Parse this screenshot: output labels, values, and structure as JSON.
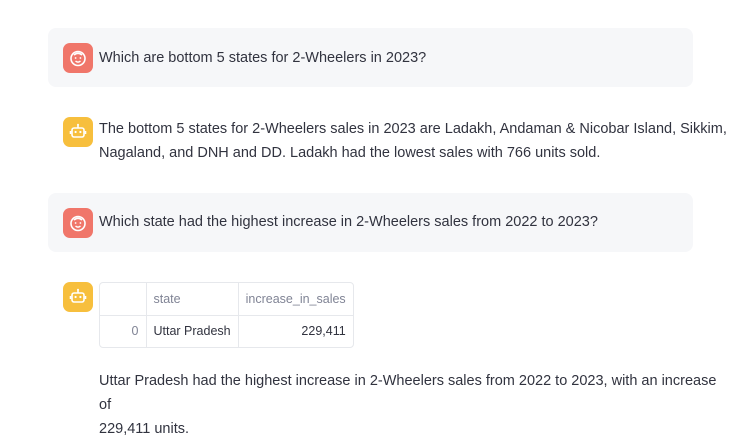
{
  "colors": {
    "user_avatar": "#f0766a",
    "assistant_avatar": "#f7bf3d",
    "user_bubble": "#f6f7f9",
    "text": "#31333f"
  },
  "messages": [
    {
      "role": "user",
      "avatar_icon": "smiley-face-icon",
      "text": "Which are bottom 5 states for 2-Wheelers in 2023?"
    },
    {
      "role": "assistant",
      "avatar_icon": "robot-icon",
      "lines": [
        "The bottom 5 states for 2-Wheelers sales in 2023 are Ladakh, Andaman & Nicobar Island, Sikkim,",
        "Nagaland, and DNH and DD. Ladakh had the lowest sales with 766 units sold."
      ]
    },
    {
      "role": "user",
      "avatar_icon": "smiley-face-icon",
      "text": "Which state had the highest increase in 2-Wheelers sales from 2022 to 2023?"
    },
    {
      "role": "assistant",
      "avatar_icon": "robot-icon",
      "table": {
        "columns": [
          "",
          "state",
          "increase_in_sales"
        ],
        "rows": [
          [
            "0",
            "Uttar Pradesh",
            "229,411"
          ]
        ]
      },
      "lines": [
        "Uttar Pradesh had the highest increase in 2-Wheelers sales from 2022 to 2023, with an increase of",
        "229,411 units."
      ]
    }
  ]
}
